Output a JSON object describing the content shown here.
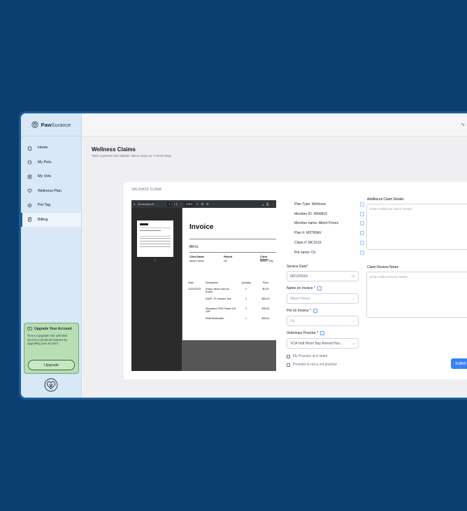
{
  "brand": {
    "bold": "Paw",
    "regular": "Surance"
  },
  "sidebar": {
    "items": [
      {
        "label": "Home",
        "icon": "home-icon"
      },
      {
        "label": "My Pets",
        "icon": "pet-icon"
      },
      {
        "label": "My Vets",
        "icon": "vet-icon"
      },
      {
        "label": "Wellness Plan",
        "icon": "heart-icon"
      },
      {
        "label": "Pet Tag",
        "icon": "tag-icon"
      },
      {
        "label": "Billing",
        "icon": "billing-icon"
      }
    ],
    "active_index": 5,
    "upgrade": {
      "title": "Upgrade Your Account",
      "text": "Time to upgrade! Get unlimited access to premium features by upgrading your account.",
      "button": "Upgrade"
    }
  },
  "header": {
    "title": "Wellness Claims",
    "subtitle": "Track expenses and validate claims using our AI technology"
  },
  "card": {
    "title": "VALIDATE CLAIM"
  },
  "viewer": {
    "filename": "Oz Invoice #1",
    "page_current": "1",
    "page_total": "/ 1",
    "zoom": "100%",
    "page_number": "1",
    "invoice": {
      "title": "Invoice",
      "bill_to": "Bill to:",
      "client_name_label": "Client Name",
      "client_name": "Albert Flores",
      "patient_label": "Patient",
      "patient": "Oz",
      "client_address_label": "Client Adress",
      "client_address": "Street , City",
      "columns": [
        "Date",
        "Description",
        "Quantity",
        "Price"
      ],
      "rows": [
        {
          "date": "12/22/2023",
          "desc": "Doctor direct visit (no Exam)",
          "qty": "1",
          "price": "$0.00"
        },
        {
          "date": "",
          "desc": "DA2P- Pv Vaccine 3wk",
          "qty": "1",
          "price": "$59.20"
        },
        {
          "date": "",
          "desc": "Simparica TRIO Purple 5.6- 11lb",
          "qty": "1",
          "price": "$35.51"
        },
        {
          "date": "",
          "desc": "Refill Medication",
          "qty": "1",
          "price": "$35.51"
        }
      ]
    }
  },
  "info": [
    "Plan Type: Wellness",
    "Member ID: 4999916",
    "Member name: Albert Flores",
    "Plan #: M3790AV",
    "Claim #: MC1516",
    "Pet name: Oz"
  ],
  "form": {
    "service_date_label": "Service Date*",
    "service_date": "06/12/2024",
    "name_label": "Name on Invoice *",
    "name_value": "Albert Flores",
    "pet_label": "Pet on Invoice *",
    "pet_value": "Oz",
    "vet_label": "Veterinary Practice *",
    "vet_value": "VCA Half Moon Bay Animal Hos...",
    "check1": "My Practice isn't listed",
    "check2": "Provider is not a vet practice"
  },
  "details": {
    "additional_label": "Additional Claim Details",
    "additional_placeholder": "Enter Additional Claim Details",
    "review_label": "Claim Review Notes",
    "review_placeholder": "Enter Claim Review Notes"
  },
  "submit_label": "SUBMI",
  "colors": {
    "background": "#0a3f70",
    "sidebar": "#d8e8f7",
    "accent": "#3b82f6",
    "upgrade": "#b7dfb3"
  }
}
